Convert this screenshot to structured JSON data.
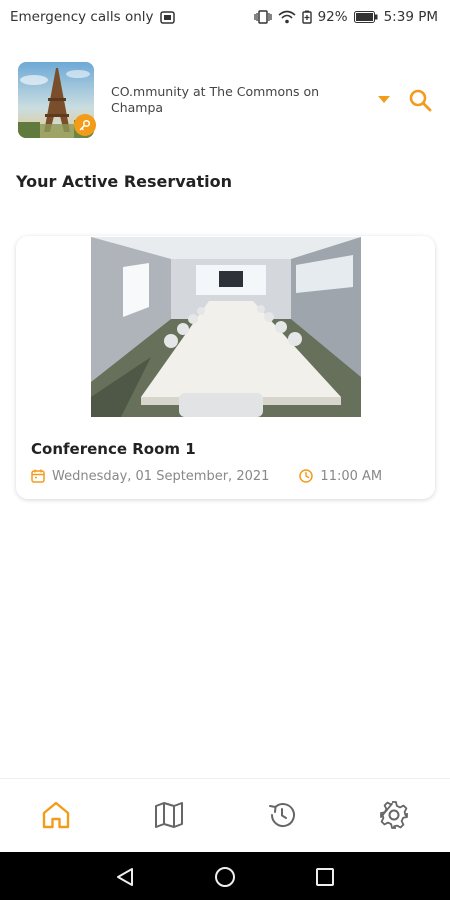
{
  "status_bar": {
    "carrier": "Emergency calls only",
    "battery": "92%",
    "time": "5:39 PM",
    "icons": [
      "sim-icon",
      "vibrate-icon",
      "wifi-icon",
      "battery-saver-icon",
      "battery-icon"
    ]
  },
  "header": {
    "community_name": "CO.mmunity at The Commons on Champa",
    "avatar_icon": "eiffel-tower-photo",
    "badge_icon": "key-icon",
    "dropdown_icon": "caret-down-icon",
    "search_icon": "search-icon"
  },
  "section_title": "Your Active Reservation",
  "reservation": {
    "room_name": "Conference Room 1",
    "date": "Wednesday, 01 September, 2021",
    "time": "11:00 AM",
    "photo": "conference-room-photo"
  },
  "bottom_nav": {
    "items": [
      {
        "name": "home",
        "icon": "home-icon",
        "active": true
      },
      {
        "name": "map",
        "icon": "map-icon",
        "active": false
      },
      {
        "name": "history",
        "icon": "history-icon",
        "active": false
      },
      {
        "name": "settings",
        "icon": "gear-icon",
        "active": false
      }
    ]
  },
  "system_nav": {
    "buttons": [
      "back-icon",
      "home-circle-icon",
      "recents-icon"
    ]
  },
  "colors": {
    "accent": "#F39C1A",
    "text_dark": "#222222",
    "text_muted": "#888888",
    "nav_inactive": "#666666"
  }
}
